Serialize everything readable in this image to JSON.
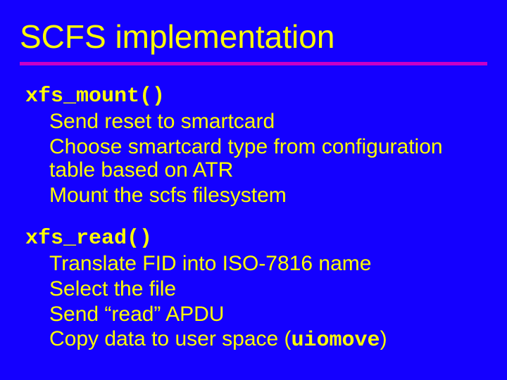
{
  "title": "SCFS implementation",
  "sections": [
    {
      "heading": "xfs_mount()",
      "items": [
        "Send reset to smartcard",
        "Choose smartcard type from configuration table based on ATR",
        "Mount the scfs filesystem"
      ]
    },
    {
      "heading": "xfs_read()",
      "items": [
        "Translate FID into ISO-7816 name",
        "Select the file",
        "Send “read” APDU",
        "Copy data to user space (uiomove)"
      ]
    }
  ],
  "mono_token": "uiomove"
}
